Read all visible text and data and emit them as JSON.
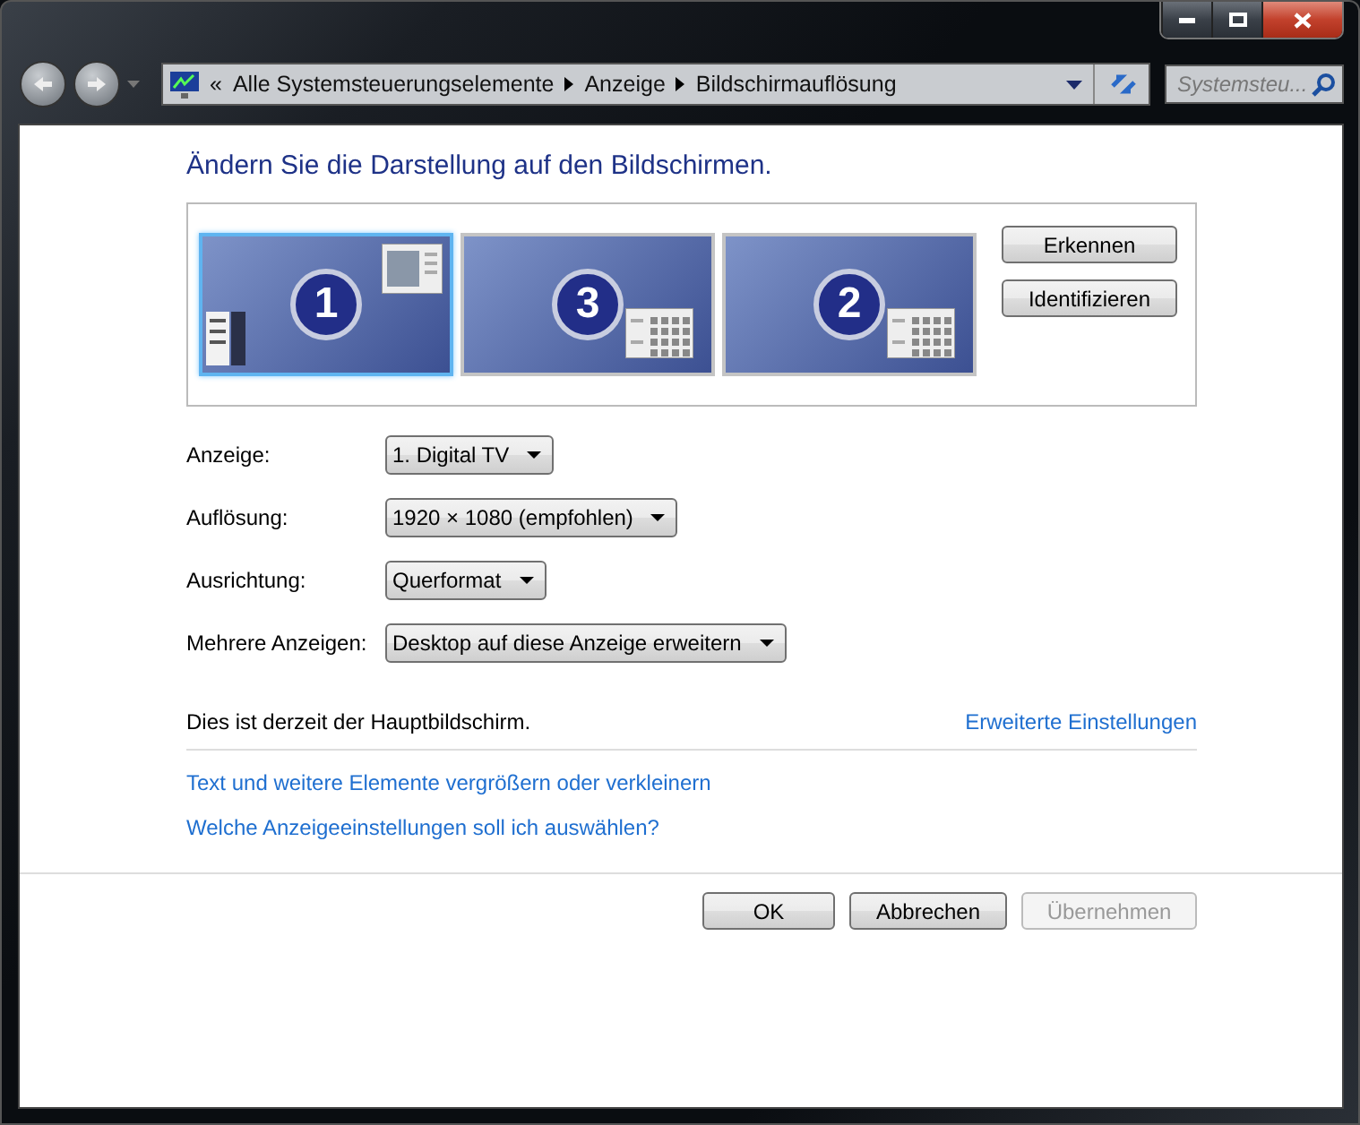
{
  "breadcrumb": {
    "overflow": "«",
    "items": [
      "Alle Systemsteuerungselemente",
      "Anzeige",
      "Bildschirmauflösung"
    ]
  },
  "search": {
    "placeholder": "Systemsteu..."
  },
  "heading": "Ändern Sie die Darstellung auf den Bildschirmen.",
  "monitors": [
    {
      "number": "1",
      "selected": true,
      "kind": "primary"
    },
    {
      "number": "3",
      "selected": false,
      "kind": "secondary"
    },
    {
      "number": "2",
      "selected": false,
      "kind": "secondary"
    }
  ],
  "monitor_buttons": [
    "Erkennen",
    "Identifizieren"
  ],
  "settings": [
    {
      "label": "Anzeige:",
      "value": "1. Digital TV"
    },
    {
      "label": "Auflösung:",
      "value": "1920 × 1080 (empfohlen)"
    },
    {
      "label": "Ausrichtung:",
      "value": "Querformat"
    },
    {
      "label": "Mehrere Anzeigen:",
      "value": "Desktop auf diese Anzeige erweitern"
    }
  ],
  "status": "Dies ist derzeit der Hauptbildschirm.",
  "advanced_link": "Erweiterte Einstellungen",
  "links": [
    "Text und weitere Elemente vergrößern oder verkleinern",
    "Welche Anzeigeeinstellungen soll ich auswählen?"
  ],
  "buttons": [
    {
      "label": "OK",
      "disabled": false
    },
    {
      "label": "Abbrechen",
      "disabled": false
    },
    {
      "label": "Übernehmen",
      "disabled": true
    }
  ]
}
